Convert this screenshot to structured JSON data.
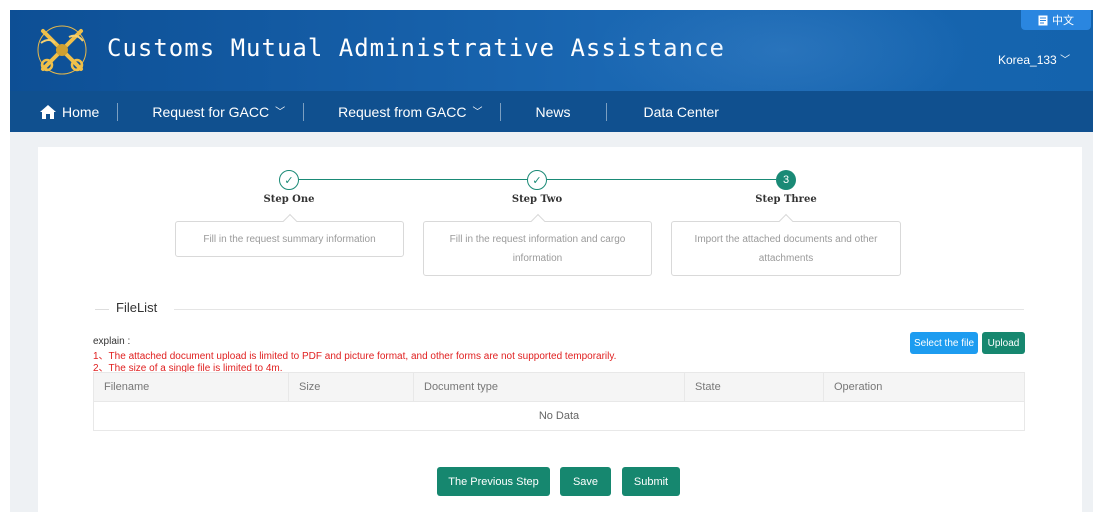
{
  "header": {
    "title": "Customs Mutual Administrative Assistance",
    "language_button": "中文",
    "language_icon": "document-icon",
    "user": "Korea_133"
  },
  "nav": {
    "items": [
      {
        "label": "Home",
        "icon": "home-icon"
      },
      {
        "label": "Request for GACC",
        "dropdown": true
      },
      {
        "label": "Request from GACC",
        "dropdown": true
      },
      {
        "label": "News"
      },
      {
        "label": "Data Center"
      }
    ]
  },
  "steps": [
    {
      "title": "Step One",
      "status": "done",
      "description": "Fill in the request summary information"
    },
    {
      "title": "Step Two",
      "status": "done",
      "description": "Fill in the request information and cargo information"
    },
    {
      "title": "Step Three",
      "status": "active",
      "number": "3",
      "description": "Import the attached documents and other attachments"
    }
  ],
  "filelist": {
    "title": "FileList",
    "explain_label": "explain :",
    "explain_lines": [
      "1、The attached document upload is limited to PDF and picture format, and other forms are not supported temporarily.",
      "2、The size of a single file is limited to 4m."
    ],
    "select_button": "Select the file",
    "upload_button": "Upload",
    "columns": [
      "Filename",
      "Size",
      "Document type",
      "State",
      "Operation"
    ],
    "empty_text": "No Data"
  },
  "footer_buttons": {
    "previous": "The Previous Step",
    "save": "Save",
    "submit": "Submit"
  },
  "colors": {
    "header_blue": "#1463ad",
    "nav_blue": "#10508f",
    "accent_green": "#1a8a76",
    "button_blue": "#1d9cf0",
    "warning_red": "#e02020"
  }
}
